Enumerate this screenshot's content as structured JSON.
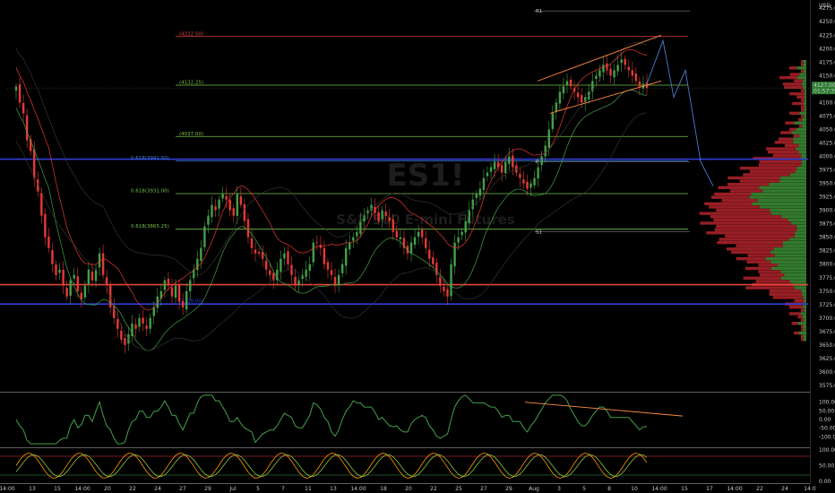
{
  "chart_data": {
    "type": "candlestick",
    "watermark": {
      "symbol": "ES1!",
      "name": "S&P 500 E-mini Futures"
    },
    "currency": "USD",
    "price_axis": {
      "ylim": [
        3565,
        4287
      ],
      "ticks": [
        4275,
        4250,
        4225,
        4200,
        4175,
        4150,
        4125,
        4100,
        4075,
        4050,
        4025,
        4000,
        3975,
        3950,
        3925,
        3900,
        3875,
        3850,
        3825,
        3800,
        3775,
        3750,
        3725,
        3700,
        3675,
        3650,
        3625,
        3600,
        3575,
        3550
      ]
    },
    "last_price": {
      "value": "4127.00",
      "countdown": "01:57:39"
    },
    "time_axis": {
      "labels": [
        "14:00",
        "13",
        "15",
        "14:00",
        "20",
        "22",
        "24",
        "27",
        "29",
        "Jul",
        "5",
        "7",
        "11",
        "13",
        "14:00",
        "18",
        "20",
        "22",
        "25",
        "27",
        "29",
        "Aug",
        "3",
        "5",
        "8",
        "10",
        "14:00",
        "15",
        "17",
        "14:00",
        "22",
        "24",
        "14:0"
      ]
    },
    "x_domain": [
      0,
      300
    ],
    "levels": [
      {
        "price": 4222.5,
        "label": "(4222.50)",
        "color": "#e0453a"
      },
      {
        "price": 4132.25,
        "label": "(4132.25)",
        "color": "#77c045"
      },
      {
        "price": 4037.0,
        "label": "(4037.00)",
        "color": "#77c045"
      },
      {
        "price": 3995.0,
        "label": "",
        "color": "#2f3fd6"
      },
      {
        "price": 3991.5,
        "label": "0.618(3991.50)",
        "color": "#3a7bd5"
      },
      {
        "price": 3931.0,
        "label": "0.618(3931.00)",
        "color": "#77c045"
      },
      {
        "price": 3865.0,
        "label": "0.618(3865.25)",
        "color": "#77c045"
      },
      {
        "price": 3762.0,
        "label": "",
        "color": "#e0453a"
      },
      {
        "price": 3726.0,
        "label": "(3726.00)",
        "color": "#2f3fd6"
      }
    ],
    "pivots": [
      {
        "label": "R1",
        "price": 4270
      },
      {
        "label": "P",
        "price": 3990
      },
      {
        "label": "S1",
        "price": 3860
      }
    ],
    "candles_close": [
      4130,
      4100,
      4080,
      4030,
      4010,
      3960,
      3935,
      3890,
      3850,
      3830,
      3800,
      3780,
      3790,
      3760,
      3740,
      3770,
      3780,
      3750,
      3735,
      3760,
      3790,
      3770,
      3790,
      3820,
      3780,
      3760,
      3720,
      3700,
      3680,
      3660,
      3650,
      3670,
      3690,
      3680,
      3700,
      3690,
      3680,
      3700,
      3720,
      3740,
      3750,
      3770,
      3760,
      3740,
      3760,
      3730,
      3720,
      3750,
      3770,
      3790,
      3810,
      3830,
      3870,
      3890,
      3910,
      3900,
      3920,
      3930,
      3920,
      3900,
      3890,
      3930,
      3910,
      3880,
      3850,
      3830,
      3820,
      3820,
      3810,
      3790,
      3780,
      3770,
      3790,
      3810,
      3820,
      3800,
      3780,
      3760,
      3770,
      3780,
      3790,
      3800,
      3840,
      3840,
      3830,
      3800,
      3790,
      3780,
      3760,
      3780,
      3800,
      3830,
      3840,
      3850,
      3860,
      3880,
      3890,
      3900,
      3910,
      3895,
      3880,
      3900,
      3890,
      3880,
      3860,
      3850,
      3850,
      3830,
      3820,
      3840,
      3850,
      3860,
      3850,
      3830,
      3810,
      3800,
      3780,
      3760,
      3750,
      3740,
      3800,
      3840,
      3850,
      3860,
      3880,
      3900,
      3920,
      3930,
      3940,
      3960,
      3970,
      3980,
      3990,
      3980,
      3970,
      3990,
      4000,
      3980,
      3970,
      3960,
      3950,
      3940,
      3950,
      3960,
      3980,
      4000,
      4020,
      4050,
      4080,
      4100,
      4120,
      4130,
      4140,
      4130,
      4120,
      4110,
      4100,
      4110,
      4120,
      4140,
      4150,
      4160,
      4170,
      4160,
      4150,
      4160,
      4170,
      4180,
      4170,
      4160,
      4150,
      4140,
      4130,
      4135,
      4127
    ],
    "oscillator1": {
      "ylim": [
        -150,
        150
      ],
      "ticks": [
        150.0,
        100.0,
        50.0,
        0.0,
        -50.0,
        -100.0
      ]
    },
    "oscillator2": {
      "ylim": [
        0,
        100
      ],
      "ticks": [
        100.0,
        50.0,
        0.0
      ]
    }
  }
}
